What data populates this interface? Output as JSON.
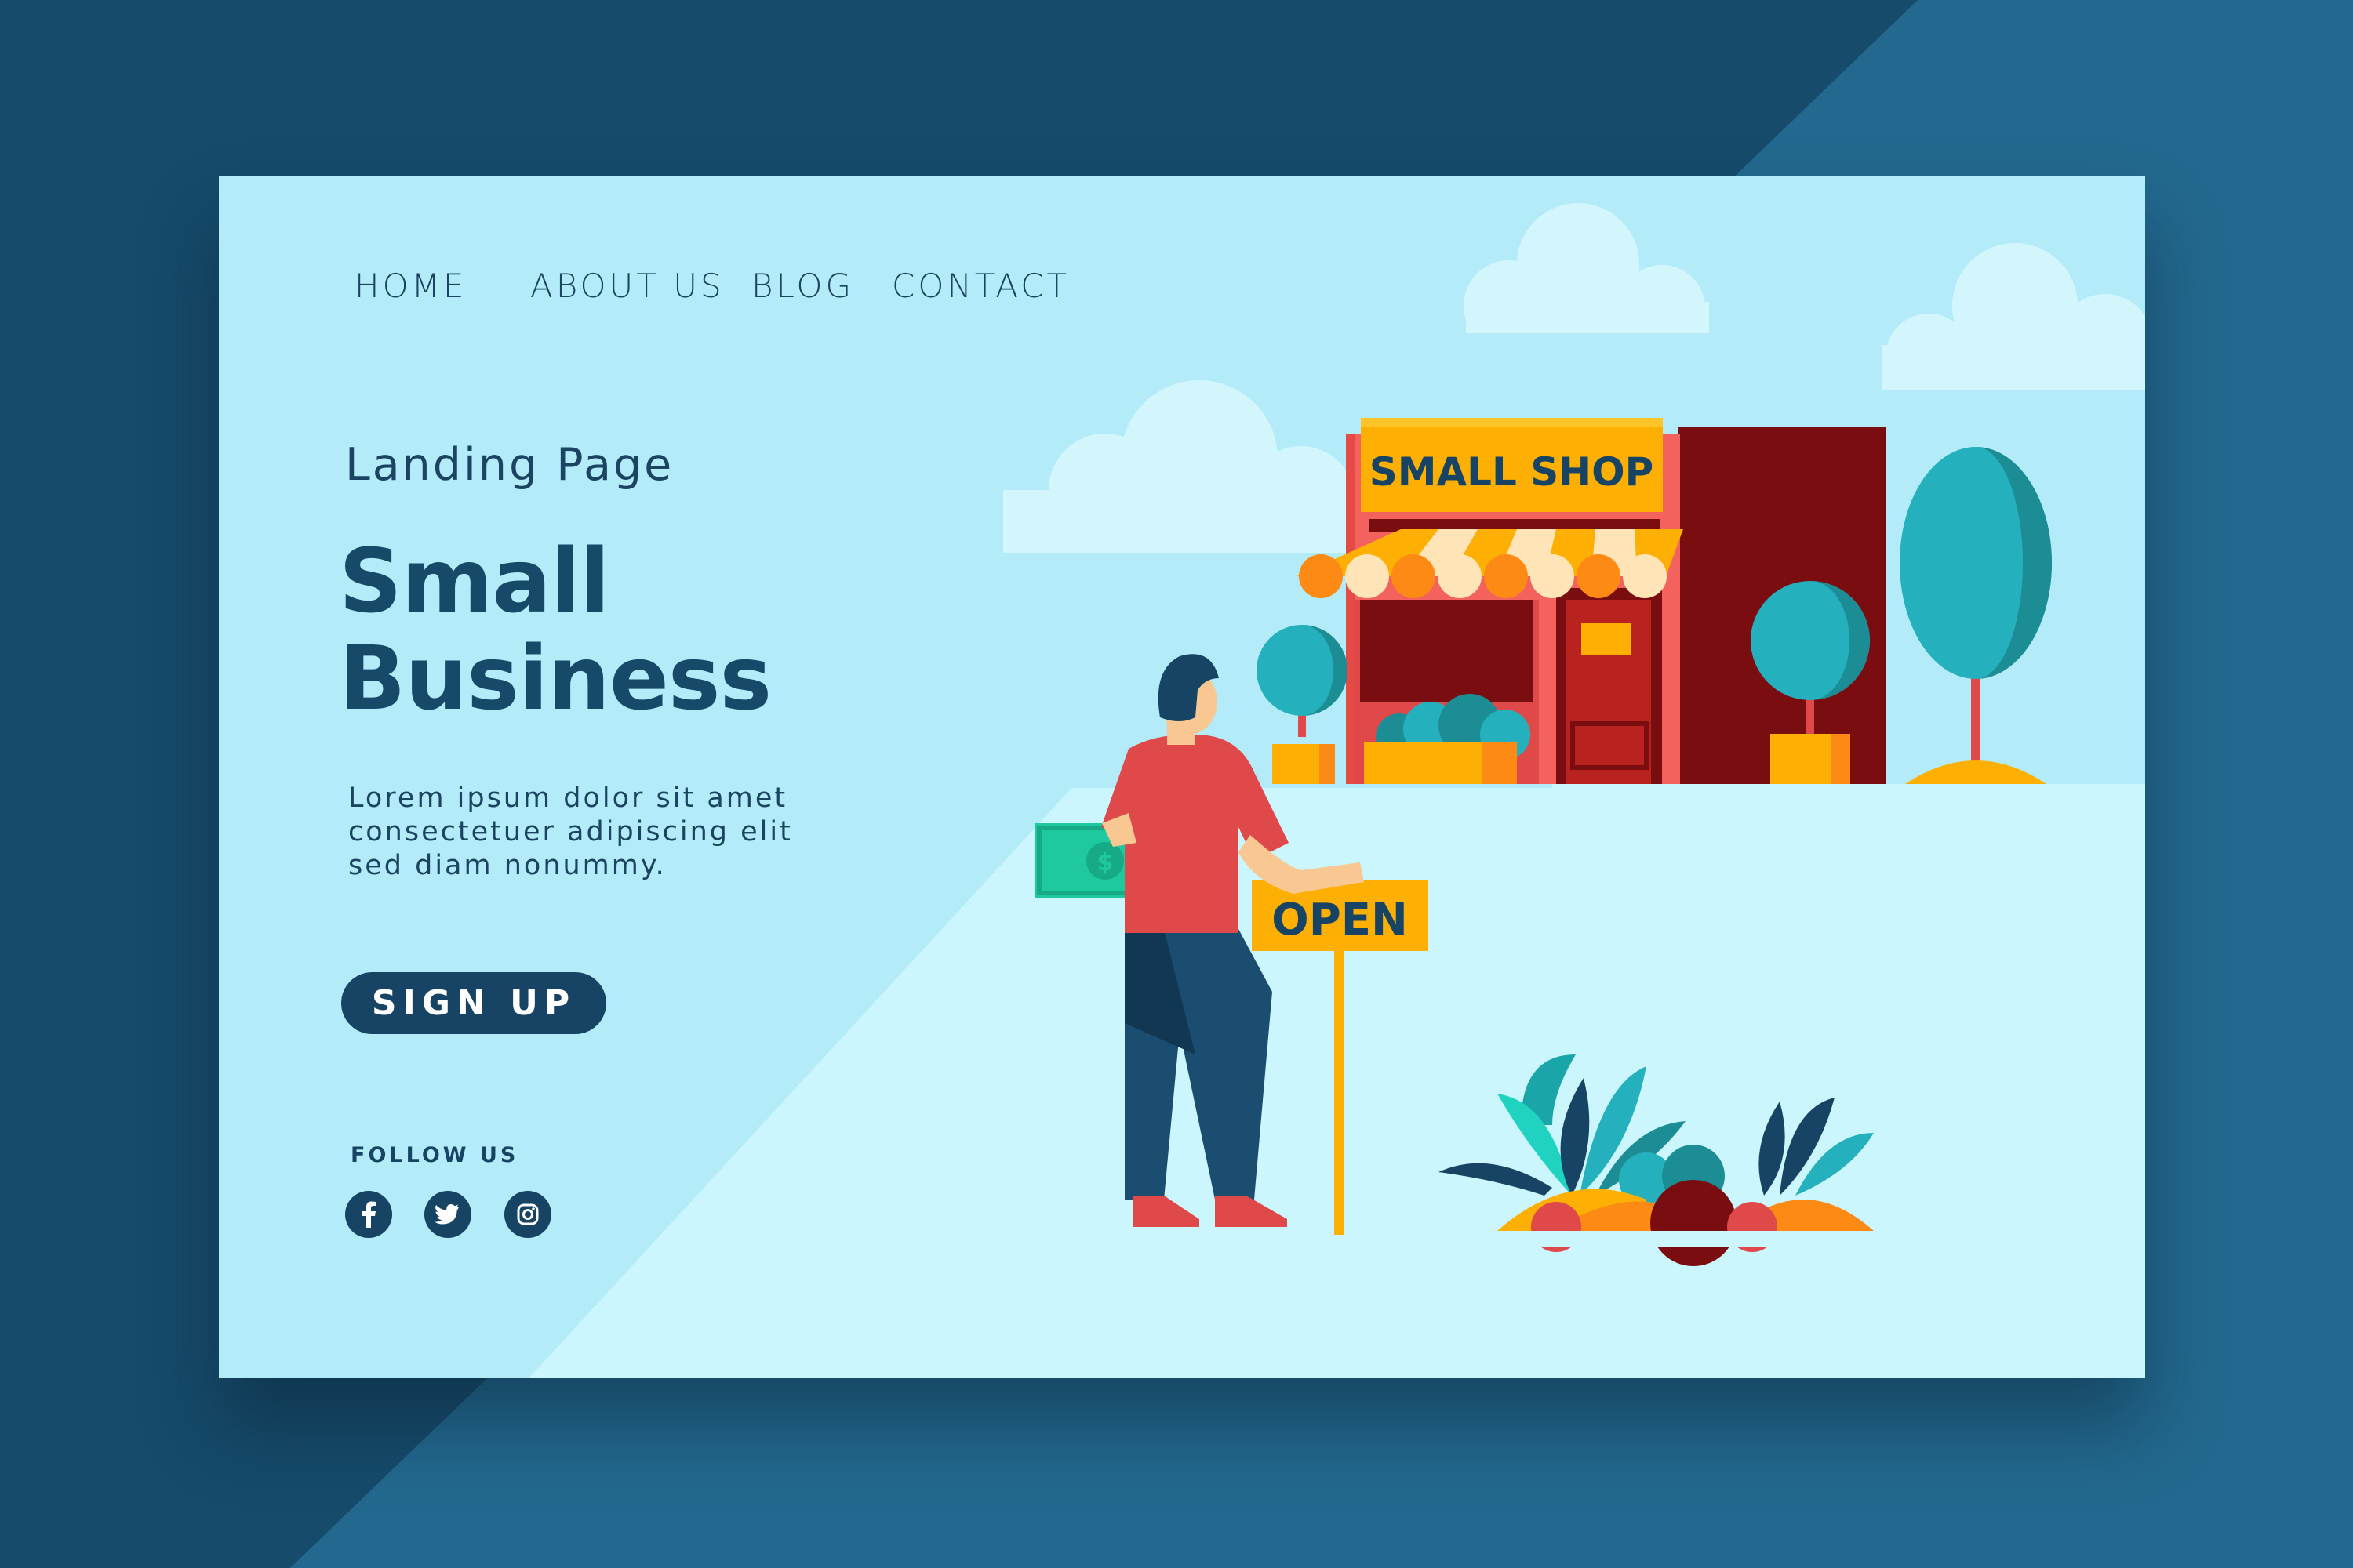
{
  "nav": {
    "items": [
      "HOME",
      "ABOUT US",
      "BLOG",
      "CONTACT"
    ]
  },
  "hero": {
    "subtitle": "Landing Page",
    "title_line1": "Small",
    "title_line2": "Business",
    "body_lines": [
      "Lorem ipsum dolor sit amet",
      "consectetuer adipiscing elit",
      "sed diam nonummy."
    ],
    "signup_label": "SIGN  UP"
  },
  "social": {
    "follow_label": "FOLLOW US",
    "icons": [
      "facebook-icon",
      "twitter-icon",
      "instagram-icon"
    ]
  },
  "illustration": {
    "shop_sign": "SMALL SHOP",
    "open_sign": "OPEN"
  },
  "colors": {
    "page_background": "#164b6b",
    "card_background": "#b3ecf8",
    "floor": "#cbf6fd",
    "navy": "#174464",
    "shop_red": "#7a0d0f",
    "accent_orange": "#fdb003",
    "shirt_red": "#e0493f",
    "teal": "#24b1bd"
  }
}
